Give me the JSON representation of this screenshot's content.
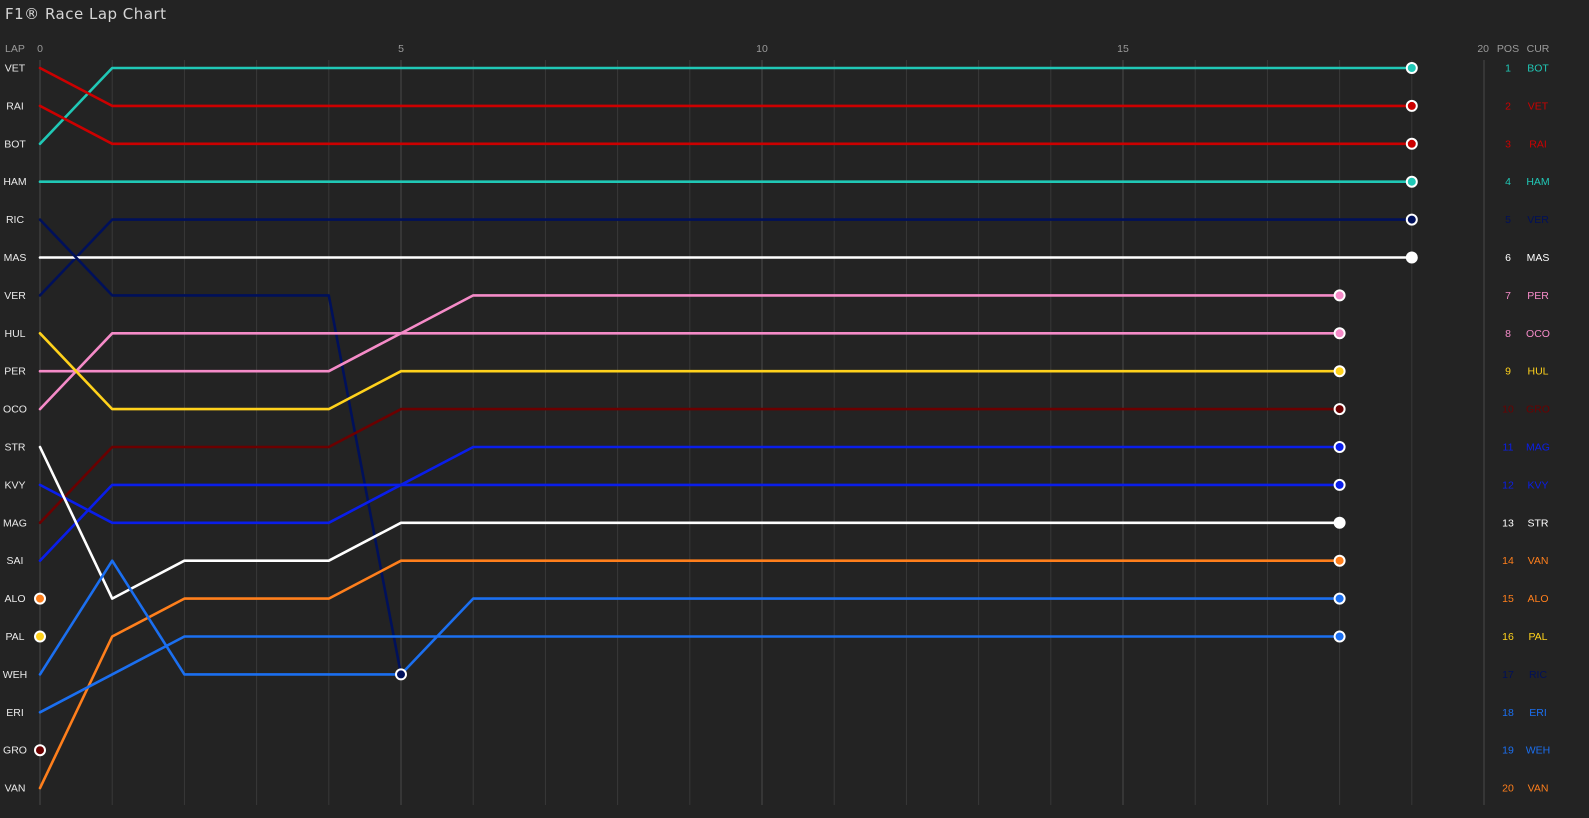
{
  "app": {
    "title": "F1® Race Lap Chart"
  },
  "chart_data": {
    "type": "line",
    "title": "",
    "xlabel": "LAP",
    "ylabel": "",
    "x_ticks": [
      0,
      5,
      10,
      15,
      20
    ],
    "xlim": [
      0,
      20
    ],
    "ylim": [
      1,
      20
    ],
    "y_reversed": true,
    "grid": "vertical lines every lap",
    "legend": "left: starting grid order; right: POS / CUR (current position order)",
    "header_left": "LAP",
    "header_pos": "POS",
    "header_cur": "CUR",
    "start_order": [
      "VET",
      "RAI",
      "BOT",
      "HAM",
      "RIC",
      "MAS",
      "VER",
      "HUL",
      "PER",
      "OCO",
      "STR",
      "KVY",
      "MAG",
      "SAI",
      "ALO",
      "PAL",
      "WEH",
      "ERI",
      "GRO",
      "VAN"
    ],
    "current_order": [
      {
        "pos": "1",
        "driver": "BOT",
        "color": "#20c8b6"
      },
      {
        "pos": "2",
        "driver": "VET",
        "color": "#cc0000"
      },
      {
        "pos": "3",
        "driver": "RAI",
        "color": "#cc0000"
      },
      {
        "pos": "4",
        "driver": "HAM",
        "color": "#20c8b6"
      },
      {
        "pos": "5",
        "driver": "VER",
        "color": "#00105a"
      },
      {
        "pos": "6",
        "driver": "MAS",
        "color": "#ffffff"
      },
      {
        "pos": "7",
        "driver": "PER",
        "color": "#f58bc8"
      },
      {
        "pos": "8",
        "driver": "OCO",
        "color": "#f58bc8"
      },
      {
        "pos": "9",
        "driver": "HUL",
        "color": "#ffd21c"
      },
      {
        "pos": "10",
        "driver": "GRO",
        "color": "#6b0000"
      },
      {
        "pos": "11",
        "driver": "MAG",
        "color": "#0a1eea"
      },
      {
        "pos": "12",
        "driver": "KVY",
        "color": "#0a1eea"
      },
      {
        "pos": "13",
        "driver": "STR",
        "color": "#ffffff"
      },
      {
        "pos": "14",
        "driver": "VAN",
        "color": "#ff7f1c"
      },
      {
        "pos": "15",
        "driver": "ALO",
        "color": "#ff7f1c"
      },
      {
        "pos": "16",
        "driver": "PAL",
        "color": "#ffd21c"
      },
      {
        "pos": "17",
        "driver": "RIC",
        "color": "#00105a"
      },
      {
        "pos": "18",
        "driver": "ERI",
        "color": "#1b6ff0"
      },
      {
        "pos": "19",
        "driver": "WEH",
        "color": "#1b6ff0"
      },
      {
        "pos": "20",
        "driver": "VAN",
        "color": "#ff7f1c"
      }
    ],
    "series": [
      {
        "name": "BOT",
        "color": "#20c8b6",
        "laps": [
          0,
          1,
          19
        ],
        "positions": [
          3,
          1,
          1
        ]
      },
      {
        "name": "VET",
        "color": "#cc0000",
        "laps": [
          0,
          1,
          19
        ],
        "positions": [
          1,
          2,
          2
        ]
      },
      {
        "name": "RAI",
        "color": "#cc0000",
        "laps": [
          0,
          1,
          19
        ],
        "positions": [
          2,
          3,
          3
        ]
      },
      {
        "name": "HAM",
        "color": "#20c8b6",
        "laps": [
          0,
          19
        ],
        "positions": [
          4,
          4
        ]
      },
      {
        "name": "VER",
        "color": "#00105a",
        "laps": [
          0,
          1,
          19
        ],
        "positions": [
          7,
          5,
          5
        ]
      },
      {
        "name": "MAS",
        "color": "#ffffff",
        "laps": [
          0,
          19
        ],
        "positions": [
          6,
          6
        ]
      },
      {
        "name": "RIC",
        "color": "#00105a",
        "laps": [
          0,
          1,
          4,
          5
        ],
        "positions": [
          5,
          7,
          7,
          17
        ]
      },
      {
        "name": "PER",
        "color": "#f58bc8",
        "laps": [
          0,
          1,
          4,
          6,
          18
        ],
        "positions": [
          9,
          9,
          9,
          7,
          7
        ]
      },
      {
        "name": "OCO",
        "color": "#f58bc8",
        "laps": [
          0,
          1,
          18
        ],
        "positions": [
          10,
          8,
          8
        ]
      },
      {
        "name": "HUL",
        "color": "#ffd21c",
        "laps": [
          0,
          1,
          4,
          5,
          18
        ],
        "positions": [
          8,
          10,
          10,
          9,
          9
        ]
      },
      {
        "name": "GRO",
        "color": "#6b0000",
        "laps": [
          0,
          1,
          4,
          5,
          18
        ],
        "positions": [
          13,
          11,
          11,
          10,
          10
        ]
      },
      {
        "name": "MAG",
        "color": "#0a1eea",
        "laps": [
          0,
          1,
          4,
          6,
          18
        ],
        "positions": [
          12,
          13,
          13,
          11,
          11
        ]
      },
      {
        "name": "KVY",
        "color": "#0a1eea",
        "laps": [
          0,
          1,
          18
        ],
        "positions": [
          14,
          12,
          12
        ]
      },
      {
        "name": "STR",
        "color": "#ffffff",
        "laps": [
          0,
          1,
          2,
          4,
          5,
          18
        ],
        "positions": [
          11,
          15,
          14,
          14,
          13,
          13
        ]
      },
      {
        "name": "VAN",
        "color": "#ff7f1c",
        "laps": [
          0,
          1,
          2,
          4,
          5,
          18
        ],
        "positions": [
          20,
          16,
          15,
          15,
          14,
          14
        ]
      },
      {
        "name": "ALO",
        "color": "#ff7f1c",
        "laps": [
          0
        ],
        "positions": [
          15
        ]
      },
      {
        "name": "ALO",
        "color": "#1b6ff0",
        "laps": [
          0,
          1,
          2,
          5,
          6,
          18
        ],
        "positions": [
          17,
          14,
          17,
          17,
          15,
          15
        ]
      },
      {
        "name": "PAL",
        "color": "#ffd21c",
        "laps": [
          0
        ],
        "positions": [
          16
        ]
      },
      {
        "name": "PAL",
        "color": "#1b6ff0",
        "laps": [
          0,
          2,
          18
        ],
        "positions": [
          18,
          16,
          16
        ]
      },
      {
        "name": "GRO",
        "color": "#6b0000",
        "laps": [
          0
        ],
        "positions": [
          19
        ]
      }
    ],
    "retired_markers": [
      {
        "driver": "ALO",
        "lap": 0,
        "position": 15,
        "color": "#ff7f1c"
      },
      {
        "driver": "PAL",
        "lap": 0,
        "position": 16,
        "color": "#ffd21c"
      },
      {
        "driver": "GRO",
        "lap": 0,
        "position": 19,
        "color": "#6b0000"
      }
    ]
  }
}
